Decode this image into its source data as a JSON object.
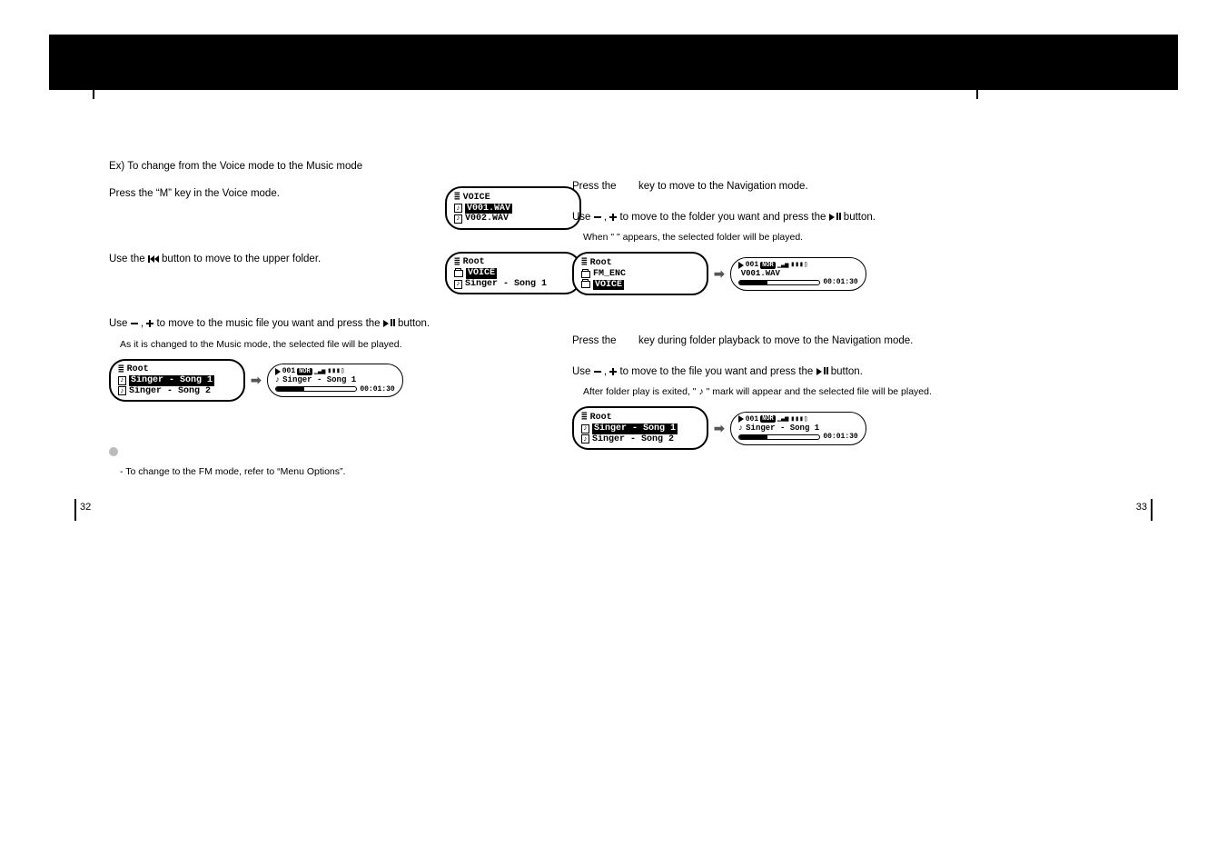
{
  "left": {
    "ex_line": "Ex) To change from the Voice mode to the Music mode",
    "step1": "Press the “M” key in the Voice mode.",
    "step2_a": "Use the ",
    "step2_b": " button to move to the upper folder.",
    "step3_a": "Use ",
    "step3_b": " to move to the music file you want and press the ",
    "step3_c": " button.",
    "step3_sub": "As it is changed to the Music mode, the selected file will be played.",
    "note_text": "- To change to the FM mode, refer to “Menu Options”.",
    "lcd1": {
      "l1": "VOICE",
      "l2": "V001.WAV",
      "l3": "V002.WAV"
    },
    "lcd2": {
      "l1": "Root",
      "l2": "VOICE",
      "l3": "Singer - Song 1"
    },
    "lcd3": {
      "l1": "Root",
      "l2": "Singer - Song 1",
      "l3": "Singer - Song 2"
    },
    "play3": {
      "track": "001",
      "title": "Singer - Song 1",
      "time": "00:01:30"
    }
  },
  "right": {
    "step1_a": "Press the ",
    "step1_b": " key to move to the Navigation mode.",
    "step2_a": "Use ",
    "step2_b": " to move to the folder you want and press the ",
    "step2_c": "  button.",
    "step2_sub_a": "When \" ",
    "step2_sub_b": " \" appears, the selected folder will be played.",
    "lcdA": {
      "l1": "Root",
      "l2": "FM_ENC",
      "l3": "VOICE"
    },
    "playA": {
      "track": "001",
      "title": "V001.WAV",
      "time": "00:01:30"
    },
    "step3_a": "Press the ",
    "step3_b": " key during folder playback to move to the Navigation mode.",
    "step4_a": "Use ",
    "step4_b": " to move to the file you want and press the ",
    "step4_c": " button.",
    "step4_sub_a": "After folder play is exited, \" ",
    "step4_sub_b": " \" mark will appear and the selected file will be played.",
    "lcdB": {
      "l1": "Root",
      "l2": "Singer - Song 1",
      "l3": "Singer - Song 2"
    },
    "playB": {
      "track": "001",
      "title": "Singer - Song 1",
      "time": "00:01:30"
    }
  },
  "badges": {
    "nor": "NOR"
  },
  "page_left": "32",
  "page_right": "33"
}
